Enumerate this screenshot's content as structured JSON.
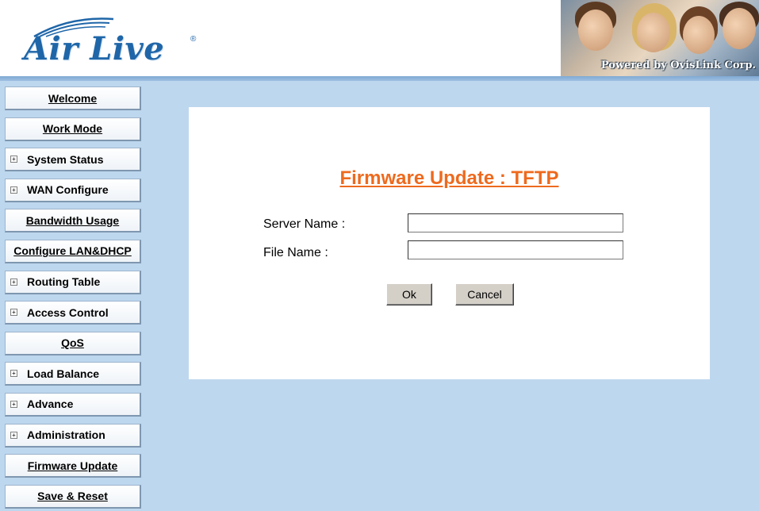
{
  "header": {
    "logo_text": "Air Live",
    "logo_reg": "®",
    "powered_by": "Powered by OvisLink Corp."
  },
  "sidebar": {
    "items": [
      {
        "label": "Welcome",
        "expandable": false
      },
      {
        "label": "Work Mode",
        "expandable": false
      },
      {
        "label": "System Status",
        "expandable": true
      },
      {
        "label": "WAN Configure",
        "expandable": true
      },
      {
        "label": "Bandwidth Usage",
        "expandable": false
      },
      {
        "label": "Configure LAN&DHCP",
        "expandable": false
      },
      {
        "label": "Routing Table",
        "expandable": true
      },
      {
        "label": "Access Control",
        "expandable": true
      },
      {
        "label": "QoS",
        "expandable": false
      },
      {
        "label": "Load Balance",
        "expandable": true
      },
      {
        "label": "Advance",
        "expandable": true
      },
      {
        "label": "Administration",
        "expandable": true
      },
      {
        "label": "Firmware Update",
        "expandable": false
      },
      {
        "label": "Save & Reset",
        "expandable": false
      }
    ],
    "expander_glyph": "+"
  },
  "main": {
    "title": "Firmware Update : TFTP",
    "server_label": "Server Name :",
    "server_value": "",
    "file_label": "File Name :",
    "file_value": "",
    "ok_label": "Ok",
    "cancel_label": "Cancel"
  },
  "colors": {
    "background": "#bdd7ee",
    "title": "#ee6a1e",
    "brand": "#1f66a8"
  }
}
